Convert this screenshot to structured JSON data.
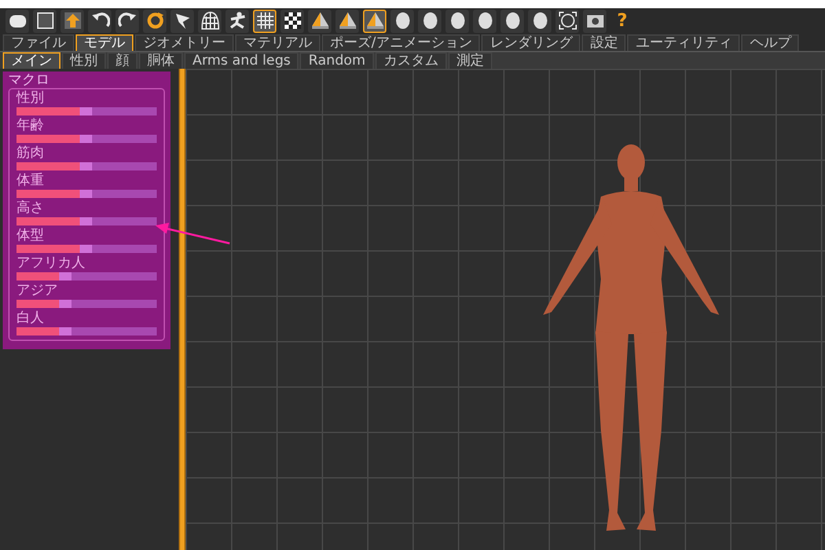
{
  "toolbar": [
    {
      "kind": "new",
      "selected": false
    },
    {
      "kind": "save",
      "selected": false
    },
    {
      "kind": "export",
      "selected": false
    },
    {
      "kind": "undo",
      "selected": false
    },
    {
      "kind": "redo",
      "selected": false
    },
    {
      "kind": "reset",
      "selected": false
    },
    {
      "kind": "pose",
      "selected": false
    },
    {
      "kind": "wireframe",
      "selected": false
    },
    {
      "kind": "figure",
      "selected": false
    },
    {
      "kind": "grid",
      "selected": true
    },
    {
      "kind": "checker",
      "selected": false
    },
    {
      "kind": "front",
      "selected": false
    },
    {
      "kind": "back",
      "selected": false
    },
    {
      "kind": "side",
      "selected": true
    },
    {
      "kind": "head",
      "selected": false
    },
    {
      "kind": "head",
      "selected": false
    },
    {
      "kind": "head",
      "selected": false
    },
    {
      "kind": "head",
      "selected": false
    },
    {
      "kind": "head",
      "selected": false
    },
    {
      "kind": "head",
      "selected": false
    },
    {
      "kind": "frame",
      "selected": false
    },
    {
      "kind": "camera",
      "selected": false
    }
  ],
  "help_button": "?",
  "tabs": [
    {
      "label": "ファイル",
      "selected": false
    },
    {
      "label": "モデル",
      "selected": true
    },
    {
      "label": "ジオメトリー",
      "selected": false
    },
    {
      "label": "マテリアル",
      "selected": false
    },
    {
      "label": "ポーズ/アニメーション",
      "selected": false
    },
    {
      "label": "レンダリング",
      "selected": false
    },
    {
      "label": "設定",
      "selected": false
    },
    {
      "label": "ユーティリティ",
      "selected": false
    },
    {
      "label": "ヘルプ",
      "selected": false
    }
  ],
  "subtabs": [
    {
      "label": "メイン",
      "selected": true
    },
    {
      "label": "性別",
      "selected": false
    },
    {
      "label": "顔",
      "selected": false
    },
    {
      "label": "胴体",
      "selected": false
    },
    {
      "label": "Arms and legs",
      "selected": false
    },
    {
      "label": "Random",
      "selected": false
    },
    {
      "label": "カスタム",
      "selected": false
    },
    {
      "label": "測定",
      "selected": false
    }
  ],
  "macro_panel": {
    "title": "マクロ",
    "sliders": [
      {
        "label": "性別",
        "level": 0.45
      },
      {
        "label": "年齢",
        "level": 0.45
      },
      {
        "label": "筋肉",
        "level": 0.45
      },
      {
        "label": "体重",
        "level": 0.45
      },
      {
        "label": "高さ",
        "level": 0.45
      },
      {
        "label": "体型",
        "level": 0.45
      },
      {
        "label": "アフリカ人",
        "level": 0.3
      },
      {
        "label": "アジア",
        "level": 0.3
      },
      {
        "label": "白人",
        "level": 0.3
      }
    ]
  }
}
